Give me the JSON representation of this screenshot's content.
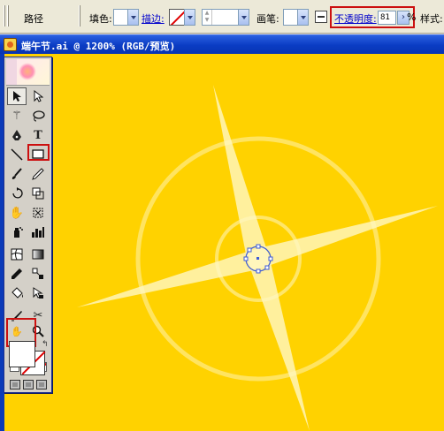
{
  "controlbar": {
    "path_label": "路径",
    "fill_label": "填色:",
    "stroke_label": "描边:",
    "brush_label": "画笔:",
    "opacity_label": "不透明度:",
    "opacity_value": "81",
    "opacity_unit": "%",
    "style_label": "样式:"
  },
  "document": {
    "title": "端午节.ai @ 1200% (RGB/预览)"
  },
  "tools": [
    {
      "name": "selection-tool",
      "icon": "arrow-icon"
    },
    {
      "name": "direct-selection-tool",
      "icon": "hollow-arrow-icon"
    },
    {
      "name": "magic-wand-tool",
      "icon": "magic-wand-icon"
    },
    {
      "name": "lasso-tool",
      "icon": "lasso-icon"
    },
    {
      "name": "pen-tool",
      "icon": "pen-icon"
    },
    {
      "name": "type-tool",
      "icon": "type-icon"
    },
    {
      "name": "line-segment-tool",
      "icon": "line-icon"
    },
    {
      "name": "rectangle-tool",
      "icon": "rectangle-icon"
    },
    {
      "name": "paintbrush-tool",
      "icon": "brush-icon"
    },
    {
      "name": "pencil-tool",
      "icon": "pencil-icon"
    },
    {
      "name": "rotate-tool",
      "icon": "rotate-icon"
    },
    {
      "name": "scale-tool",
      "icon": "scale-icon"
    },
    {
      "name": "warp-tool",
      "icon": "warp-icon"
    },
    {
      "name": "free-transform-tool",
      "icon": "free-transform-icon"
    },
    {
      "name": "symbol-sprayer-tool",
      "icon": "sprayer-icon"
    },
    {
      "name": "column-graph-tool",
      "icon": "graph-icon"
    },
    {
      "name": "mesh-tool",
      "icon": "mesh-icon"
    },
    {
      "name": "gradient-tool",
      "icon": "gradient-icon"
    },
    {
      "name": "eyedropper-tool",
      "icon": "eyedropper-icon"
    },
    {
      "name": "blend-tool",
      "icon": "blend-icon"
    },
    {
      "name": "live-paint-bucket-tool",
      "icon": "paint-bucket-icon"
    },
    {
      "name": "live-paint-selection-tool",
      "icon": "paint-select-icon"
    },
    {
      "name": "slice-tool",
      "icon": "slice-icon"
    },
    {
      "name": "scissors-tool",
      "icon": "scissors-icon"
    },
    {
      "name": "hand-tool",
      "icon": "hand-icon"
    },
    {
      "name": "zoom-tool",
      "icon": "zoom-icon"
    }
  ],
  "colors": {
    "canvas_yellow": "#ffd200",
    "title_blue": "#0a3cc3",
    "highlight_red": "#cc1010",
    "starburst": "#fff3b0"
  },
  "selected_tool": "selection-tool",
  "highlighted": [
    "rectangle-tool",
    "fill-stroke-swatches",
    "opacity-control"
  ]
}
